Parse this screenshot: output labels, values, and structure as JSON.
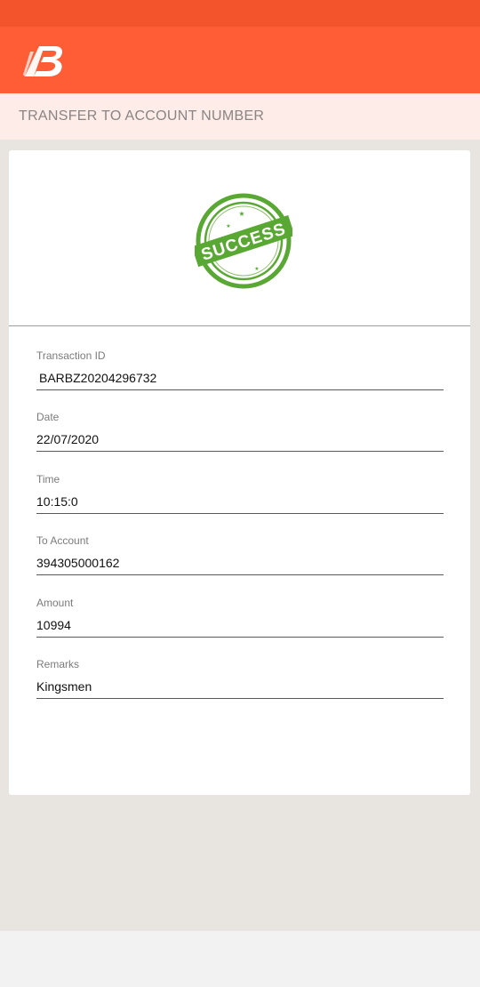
{
  "header": {
    "logo_icon": "bank-of-baroda-logo-icon",
    "brand_color": "#fe5d35"
  },
  "title_bar": {
    "title": "TRANSFER TO ACCOUNT NUMBER"
  },
  "status": {
    "stamp_text": "SUCCESS",
    "stamp_icon": "success-stamp-icon",
    "stamp_color": "#5aa834"
  },
  "fields": [
    {
      "label": "Transaction ID",
      "value": "BARBZ20204296732"
    },
    {
      "label": "Date",
      "value": "22/07/2020"
    },
    {
      "label": "Time",
      "value": "10:15:0"
    },
    {
      "label": "To Account",
      "value": "394305000162"
    },
    {
      "label": "Amount",
      "value": "10994"
    },
    {
      "label": "Remarks",
      "value": "Kingsmen"
    }
  ]
}
